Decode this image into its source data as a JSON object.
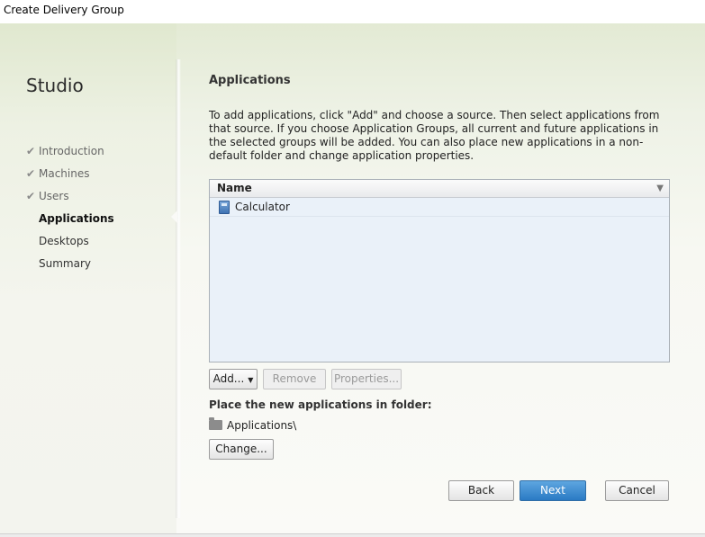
{
  "window": {
    "title": "Create Delivery Group"
  },
  "sidebar": {
    "app_name": "Studio",
    "steps": [
      {
        "label": "Introduction",
        "state": "done",
        "icon": "check-icon"
      },
      {
        "label": "Machines",
        "state": "done",
        "icon": "check-icon"
      },
      {
        "label": "Users",
        "state": "done",
        "icon": "check-icon"
      },
      {
        "label": "Applications",
        "state": "active"
      },
      {
        "label": "Desktops",
        "state": "pending"
      },
      {
        "label": "Summary",
        "state": "pending"
      }
    ]
  },
  "main": {
    "title": "Applications",
    "intro": "To add applications, click \"Add\" and choose a source. Then select applications from that source. If you choose Application Groups, all current and future applications in the selected groups will be added. You can also place new applications in a non-default folder and change application properties.",
    "list": {
      "column_header": "Name",
      "sort_icon": "sort-down-icon",
      "rows": [
        {
          "name": "Calculator",
          "icon": "calculator-icon"
        }
      ]
    },
    "buttons": {
      "add": "Add...",
      "remove": "Remove",
      "properties": "Properties..."
    },
    "folder": {
      "label": "Place the new applications in folder:",
      "path": "Applications\\",
      "icon": "folder-icon",
      "change_button": "Change..."
    }
  },
  "footer": {
    "back": "Back",
    "next": "Next",
    "cancel": "Cancel"
  },
  "colors": {
    "primary_button": "#2a7ac4",
    "list_background": "#eaf1f9",
    "pane_gradient_top": "#e0e8cf"
  }
}
